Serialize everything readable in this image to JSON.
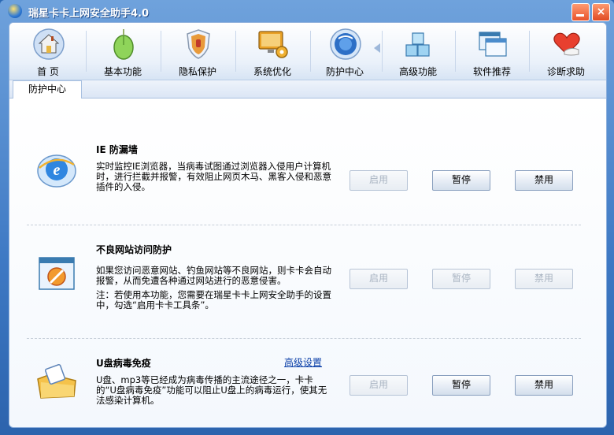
{
  "window": {
    "title": "瑞星卡卡上网安全助手4.0",
    "close_label": "×"
  },
  "toolbar": {
    "items": [
      {
        "label": "首 页",
        "icon": "home-icon"
      },
      {
        "label": "基本功能",
        "icon": "mouse-icon"
      },
      {
        "label": "隐私保护",
        "icon": "shield-icon"
      },
      {
        "label": "系统优化",
        "icon": "monitor-gear-icon"
      },
      {
        "label": "防护中心",
        "icon": "globe-icon"
      },
      {
        "label": "高级功能",
        "icon": "cubes-icon"
      },
      {
        "label": "软件推荐",
        "icon": "windows-icon"
      },
      {
        "label": "诊断求助",
        "icon": "heart-hands-icon"
      }
    ],
    "active_index": 4
  },
  "tab": {
    "label": "防护中心"
  },
  "sections": [
    {
      "title": "IE 防漏墙",
      "desc": "实时监控IE浏览器，当病毒试图通过浏览器入侵用户计算机时，进行拦截并报警，有效阻止网页木马、黑客入侵和恶意插件的入侵。",
      "buttons": [
        "启用",
        "暂停",
        "禁用"
      ],
      "enabled": [
        false,
        true,
        true
      ]
    },
    {
      "title": "不良网站访问防护",
      "desc": "如果您访问恶意网站、钓鱼网站等不良网站，则卡卡会自动报警，从而免遭各种通过网站进行的恶意侵害。",
      "note": "注：若使用本功能，您需要在瑞星卡卡上网安全助手的设置中，勾选“启用卡卡工具条”。",
      "buttons": [
        "启用",
        "暂停",
        "禁用"
      ],
      "enabled": [
        false,
        false,
        false
      ]
    },
    {
      "title": "U盘病毒免疫",
      "link": "高级设置",
      "desc": "U盘、mp3等已经成为病毒传播的主流途径之一，卡卡的“U盘病毒免疫”功能可以阻止U盘上的病毒运行，使其无法感染计算机。",
      "buttons": [
        "启用",
        "暂停",
        "禁用"
      ],
      "enabled": [
        false,
        true,
        true
      ]
    }
  ]
}
